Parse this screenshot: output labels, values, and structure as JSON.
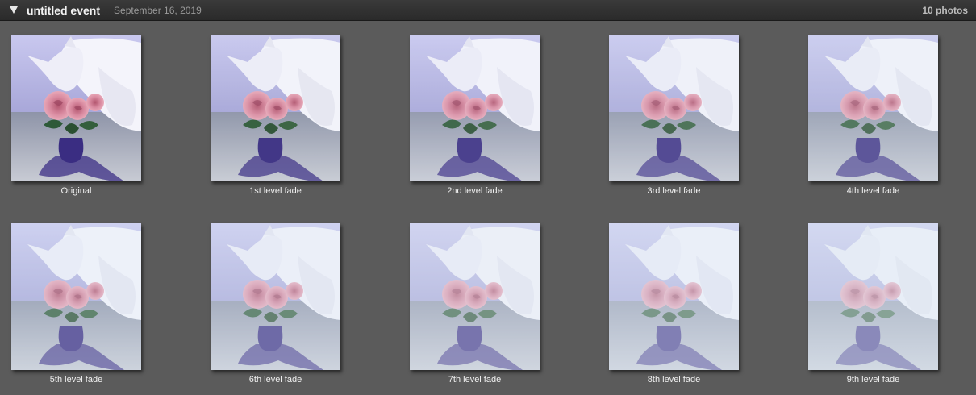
{
  "event": {
    "title": "untitled event",
    "date": "September 16, 2019",
    "photo_count": "10 photos"
  },
  "icons": {
    "disclosure": "disclosure-triangle-down-icon"
  },
  "colors": {
    "header_bg": "#2e2e2e",
    "canvas_bg": "#5b5b5b",
    "caption_text": "#f0f0f0"
  },
  "photos": [
    {
      "label": "Original",
      "fade_level": 0
    },
    {
      "label": "1st level fade",
      "fade_level": 1
    },
    {
      "label": "2nd level fade",
      "fade_level": 2
    },
    {
      "label": "3rd level fade",
      "fade_level": 3
    },
    {
      "label": "4th level fade",
      "fade_level": 4
    },
    {
      "label": "5th level fade",
      "fade_level": 5
    },
    {
      "label": "6th level fade",
      "fade_level": 6
    },
    {
      "label": "7th level fade",
      "fade_level": 7
    },
    {
      "label": "8th level fade",
      "fade_level": 8
    },
    {
      "label": "9th level fade",
      "fade_level": 9
    }
  ]
}
